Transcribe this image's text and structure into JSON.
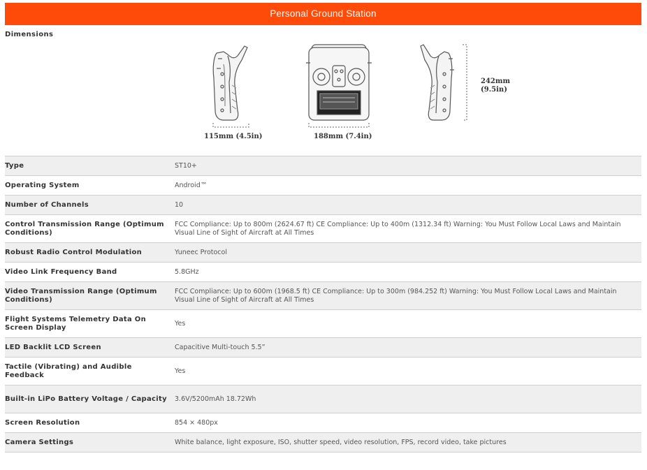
{
  "banner": {
    "title": "Personal Ground Station"
  },
  "dimensions": {
    "label": "Dimensions",
    "side_width": "115mm (4.5in)",
    "front_width": "188mm (7.4in)",
    "height_mm": "242mm",
    "height_in": "(9.5in)"
  },
  "specs": [
    {
      "key": "Type",
      "value": "ST10+"
    },
    {
      "key": "Operating System",
      "value": "Android™"
    },
    {
      "key": "Number of Channels",
      "value": "10"
    },
    {
      "key": "Control Transmission Range (Optimum Conditions)",
      "value": "FCC Compliance: Up to 800m (2624.67 ft) CE Compliance: Up to 400m (1312.34 ft) Warning: You Must Follow Local Laws and Maintain Visual Line of Sight of Aircraft at All Times"
    },
    {
      "key": "Robust Radio Control Modulation",
      "value": "Yuneec Protocol"
    },
    {
      "key": "Video Link Frequency Band",
      "value": "5.8GHz"
    },
    {
      "key": "Video Transmission Range (Optimum Conditions)",
      "value": "FCC Compliance: Up to 600m (1968.5 ft) CE Compliance: Up to 300m (984.252 ft) Warning: You Must Follow Local Laws and Maintain Visual Line of Sight of Aircraft at All Times"
    },
    {
      "key": "Flight Systems Telemetry Data On Screen Display",
      "value": "Yes"
    },
    {
      "key": "LED Backlit LCD Screen",
      "value": "Capacitive Multi-touch 5.5”"
    },
    {
      "key": "Tactile (Vibrating) and Audible Feedback",
      "value": "Yes"
    },
    {
      "key": "Built-in LiPo Battery Voltage / Capacity",
      "value": "3.6V/5200mAh 18.72Wh"
    },
    {
      "key": "Screen Resolution",
      "value": "854 × 480px"
    },
    {
      "key": "Camera Settings",
      "value": "White balance, light exposure, ISO, shutter speed, video resolution, FPS, record video, take pictures"
    }
  ]
}
